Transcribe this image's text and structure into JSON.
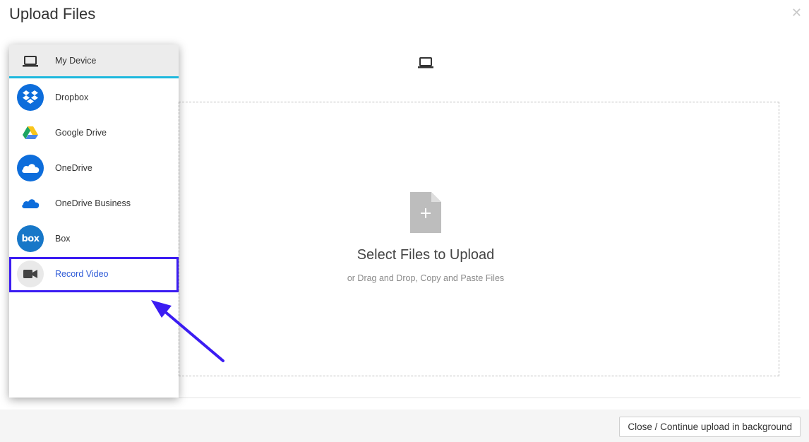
{
  "dialog": {
    "title": "Upload Files",
    "close_icon": "close-icon"
  },
  "sidebar": {
    "items": [
      {
        "label": "My Device",
        "icon": "laptop-icon",
        "selected": true
      },
      {
        "label": "Dropbox",
        "icon": "dropbox-icon"
      },
      {
        "label": "Google Drive",
        "icon": "google-drive-icon"
      },
      {
        "label": "OneDrive",
        "icon": "onedrive-icon"
      },
      {
        "label": "OneDrive Business",
        "icon": "onedrive-business-icon"
      },
      {
        "label": "Box",
        "icon": "box-icon",
        "icon_text": "box"
      },
      {
        "label": "Record Video",
        "icon": "video-camera-icon",
        "highlighted": true
      }
    ]
  },
  "main": {
    "header_icon": "laptop-icon",
    "drop_title": "Select Files to Upload",
    "drop_subtitle": "or Drag and Drop, Copy and Paste Files"
  },
  "footer": {
    "close_button": "Close / Continue upload in background"
  },
  "colors": {
    "accent_underline": "#1eb8dd",
    "highlight_box": "#3b1cf2",
    "link_blue": "#2f5bd7",
    "icon_blue": "#0d6ddb"
  }
}
